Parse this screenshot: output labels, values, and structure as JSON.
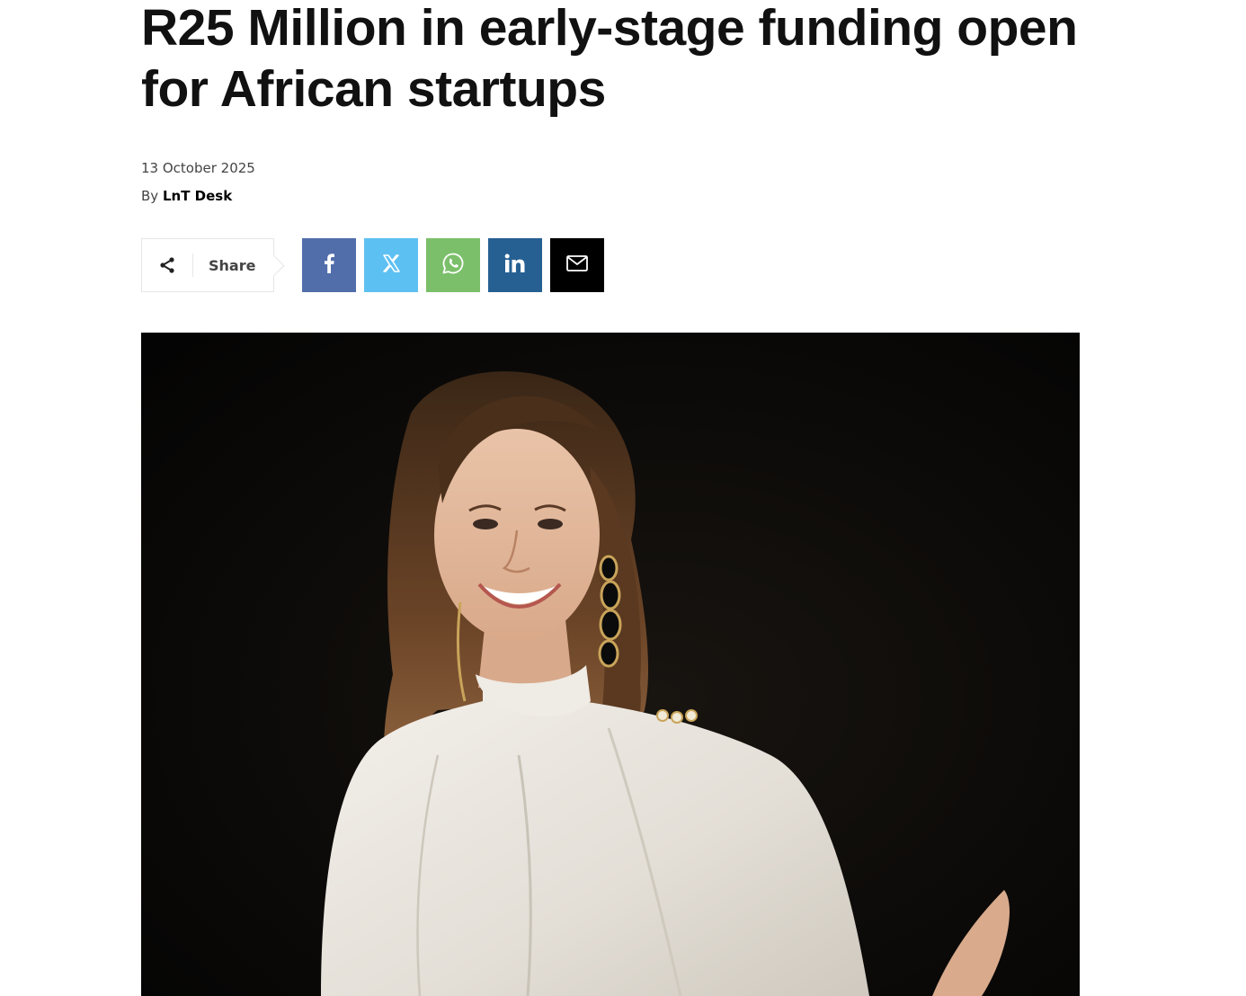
{
  "article": {
    "title": "R25 Million in early-stage funding open for African startups",
    "date": "13 October 2025",
    "byline_prefix": "By",
    "author": "LnT Desk"
  },
  "share": {
    "label": "Share",
    "icon": "share-icon",
    "buttons": [
      {
        "name": "facebook",
        "icon": "facebook-icon",
        "color": "#516eab"
      },
      {
        "name": "x",
        "icon": "x-icon",
        "color": "#5dc0f2"
      },
      {
        "name": "whatsapp",
        "icon": "whatsapp-icon",
        "color": "#7bbf6a"
      },
      {
        "name": "linkedin",
        "icon": "linkedin-icon",
        "color": "#266093"
      },
      {
        "name": "email",
        "icon": "mail-icon",
        "color": "#000000"
      }
    ]
  },
  "hero_image": {
    "subject": "portrait-photo"
  }
}
